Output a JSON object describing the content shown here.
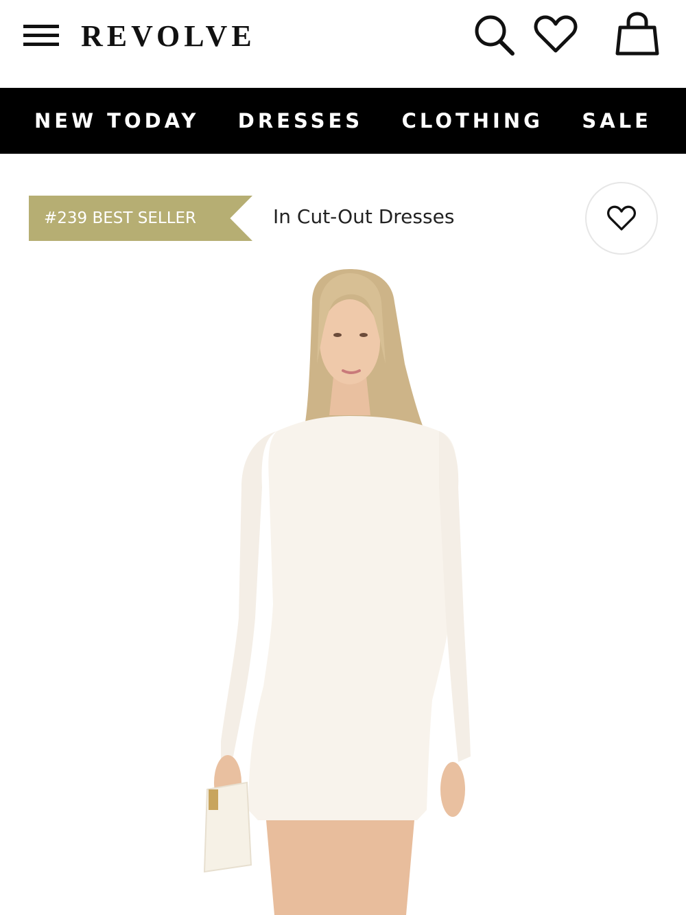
{
  "header": {
    "logo": "REVOLVE",
    "icons": [
      "menu-icon",
      "search-icon",
      "heart-icon",
      "shopping-bag-icon"
    ]
  },
  "nav": {
    "items": [
      {
        "label": "NEW TODAY"
      },
      {
        "label": "DRESSES"
      },
      {
        "label": "CLOTHING"
      },
      {
        "label": "SALE"
      }
    ]
  },
  "product": {
    "badge_text": "#239 BEST SELLER",
    "category_text": "In Cut-Out Dresses",
    "favorite_icon": "heart-outline-icon"
  },
  "colors": {
    "nav_background": "#000000",
    "badge_gold": "#b6ae73",
    "dress": "#f8f3ec",
    "background": "#ffffff"
  }
}
